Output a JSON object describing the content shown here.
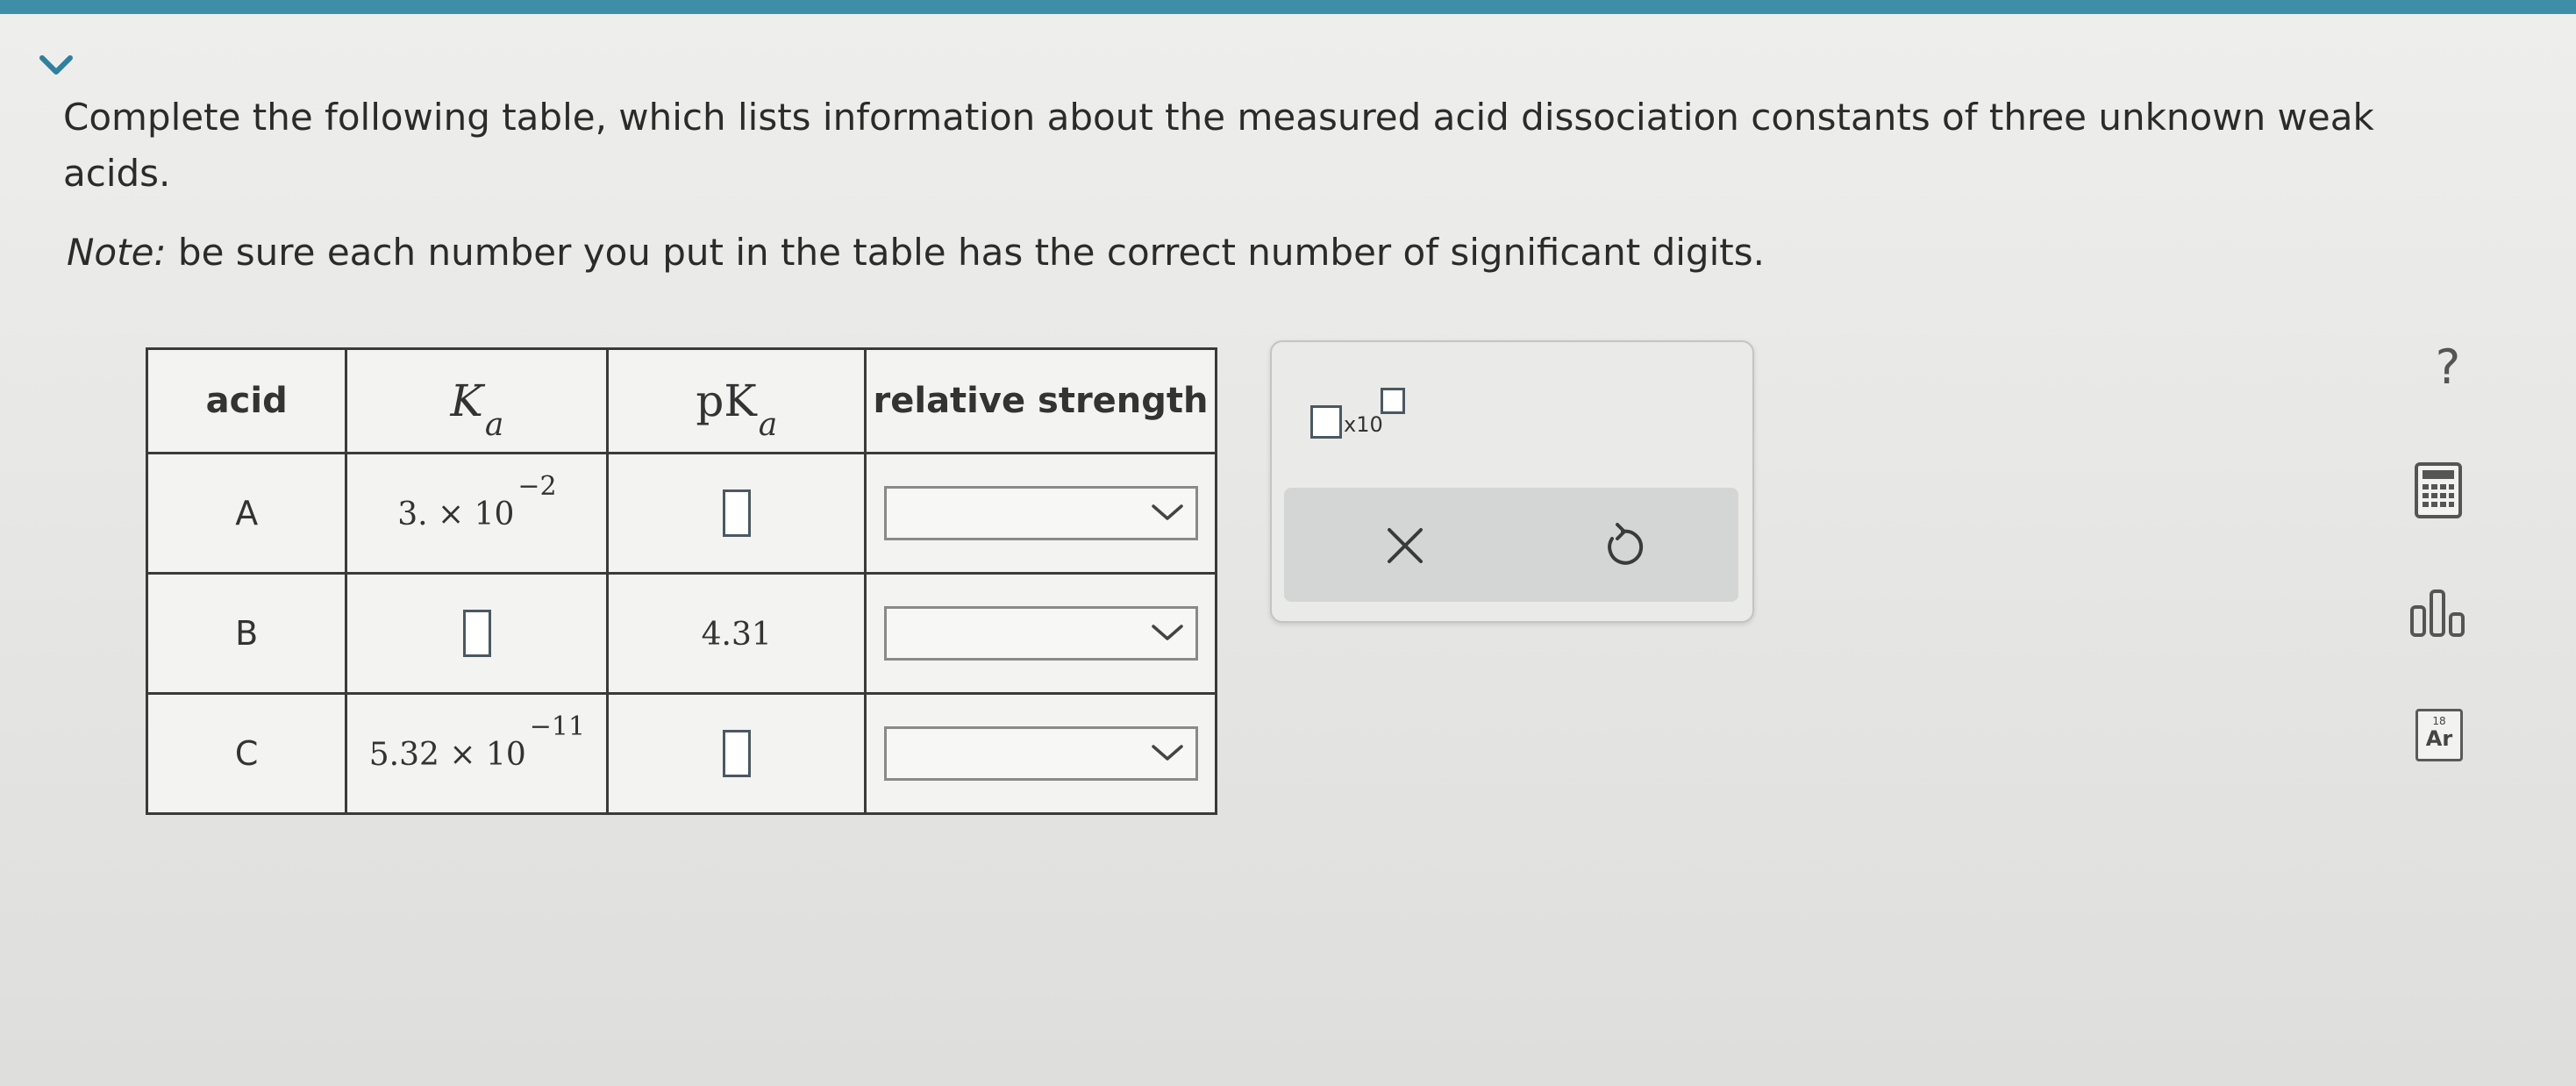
{
  "question": {
    "text": "Complete the following table, which lists information about the measured acid dissociation constants of three unknown weak acids.",
    "note_label": "Note:",
    "note_text": " be sure each number you put in the table has the correct number of significant digits."
  },
  "table": {
    "headers": {
      "acid": "acid",
      "ka_letter": "K",
      "ka_sub": "a",
      "pka_prefix": "pK",
      "pka_sub": "a",
      "relative_strength": "relative strength"
    },
    "rows": [
      {
        "acid": "A",
        "ka_mantissa": "3. × 10",
        "ka_exponent": "−2",
        "pka": "",
        "relative_strength": ""
      },
      {
        "acid": "B",
        "ka_mantissa": "",
        "ka_exponent": "",
        "pka": "4.31",
        "relative_strength": ""
      },
      {
        "acid": "C",
        "ka_mantissa": "5.32 × 10",
        "ka_exponent": "−11",
        "pka": "",
        "relative_strength": ""
      }
    ]
  },
  "tool_panel": {
    "sci_notation_label": "x10"
  },
  "side_tools": {
    "help": "?",
    "periodic_table_number": "18",
    "periodic_table_symbol": "Ar"
  },
  "colors": {
    "top_bar": "#3d8ea6",
    "chevron": "#2f7fa0"
  }
}
